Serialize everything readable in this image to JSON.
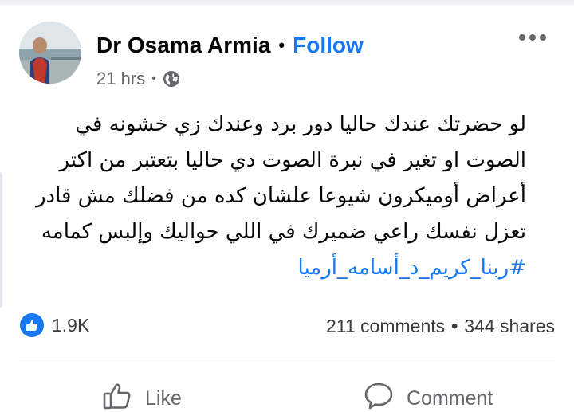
{
  "post": {
    "author_name": "Dr Osama Armia",
    "separator": "•",
    "follow_label": "Follow",
    "timestamp": "21 hrs",
    "privacy_icon": "globe-icon",
    "more_icon": "more-horizontal-icon",
    "text_lines": [
      "لو حضرتك عندك حاليا دور برد وعندك زي خشونه في",
      "الصوت او تغير في نبرة الصوت دي حاليا بتعتبر من اكتر",
      "أعراض أوميكرون شيوعا علشان كده من فضلك مش قادر",
      "تعزل نفسك راعي ضميرك في اللي حواليك وإلبس كمامه"
    ],
    "hashtag": "#ربنا_كريم_د_أسامه_أرميا"
  },
  "engagement": {
    "reaction_icon": "like-reaction-icon",
    "reaction_count": "1.9K",
    "comments": "211 comments",
    "separator": "•",
    "shares": "344 shares"
  },
  "actions": {
    "like_label": "Like",
    "comment_label": "Comment"
  },
  "colors": {
    "accent": "#1877f2",
    "secondary_text": "#65676b",
    "primary_text": "#050505"
  }
}
